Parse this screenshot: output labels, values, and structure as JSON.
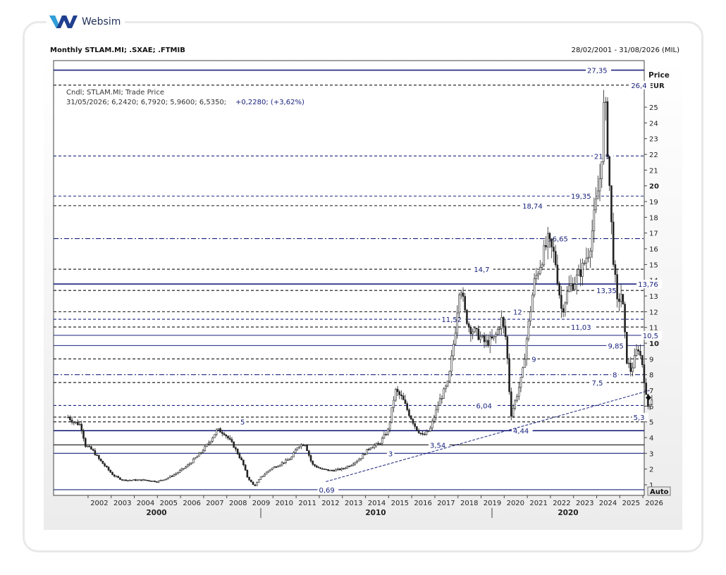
{
  "brand": {
    "name": "Websim"
  },
  "header": {
    "title": "Monthly STLAM.MI; .SXAE; .FTMIB",
    "date_range": "28/02/2001 - 31/08/2026 (MIL)"
  },
  "legend": {
    "line1": "Cndl; STLAM.MI; Trade Price",
    "ohlc": "31/05/2026; 6,2420; 6,7920; 5,9600; 6,5350;",
    "change": "+0,2280; (+3,62%)"
  },
  "axis": {
    "y_title_1": "Price",
    "y_title_2": "EUR",
    "auto_label": "Auto",
    "y_ticks": [
      "1",
      "2",
      "3",
      "4",
      "5",
      "6",
      "7",
      "8",
      "9",
      "10",
      "11",
      "12",
      "13",
      "14",
      "15",
      "16",
      "17",
      "18",
      "19",
      "20",
      "21",
      "22",
      "23",
      "24",
      "25"
    ],
    "x_ticks": [
      "2002",
      "2003",
      "2004",
      "2005",
      "2006",
      "2007",
      "2008",
      "2009",
      "2010",
      "2011",
      "2012",
      "2013",
      "2014",
      "2015",
      "2016",
      "2017",
      "2018",
      "2019",
      "2020",
      "2021",
      "2022",
      "2023",
      "2024",
      "2025",
      "2026"
    ],
    "decades": [
      "2000",
      "2010",
      "2020"
    ]
  },
  "colors": {
    "navy": "#1a237e",
    "black": "#111111",
    "candle": "#222222"
  },
  "chart_data": {
    "type": "candlestick",
    "y_unit": "EUR",
    "ylim": [
      0.3,
      27.8
    ],
    "xlim": [
      2001.1,
      2026.75
    ],
    "close_path": [
      [
        2001.15,
        5.3
      ],
      [
        2001.4,
        5.0
      ],
      [
        2001.7,
        4.8
      ],
      [
        2001.9,
        3.5
      ],
      [
        2002.2,
        3.2
      ],
      [
        2002.5,
        2.6
      ],
      [
        2002.8,
        2.1
      ],
      [
        2003.1,
        1.6
      ],
      [
        2003.5,
        1.3
      ],
      [
        2004.0,
        1.3
      ],
      [
        2004.5,
        1.3
      ],
      [
        2005.0,
        1.2
      ],
      [
        2005.4,
        1.4
      ],
      [
        2005.8,
        1.7
      ],
      [
        2006.3,
        2.2
      ],
      [
        2006.8,
        2.9
      ],
      [
        2007.2,
        3.6
      ],
      [
        2007.6,
        4.5
      ],
      [
        2007.9,
        4.3
      ],
      [
        2008.3,
        3.5
      ],
      [
        2008.7,
        2.4
      ],
      [
        2008.9,
        1.5
      ],
      [
        2009.2,
        0.9
      ],
      [
        2009.5,
        1.5
      ],
      [
        2009.9,
        2.0
      ],
      [
        2010.3,
        2.3
      ],
      [
        2010.8,
        2.7
      ],
      [
        2011.1,
        3.5
      ],
      [
        2011.4,
        3.6
      ],
      [
        2011.7,
        2.3
      ],
      [
        2012.1,
        2.0
      ],
      [
        2012.5,
        1.9
      ],
      [
        2013.0,
        2.0
      ],
      [
        2013.4,
        2.3
      ],
      [
        2013.8,
        2.7
      ],
      [
        2014.2,
        3.4
      ],
      [
        2014.6,
        3.6
      ],
      [
        2015.0,
        4.5
      ],
      [
        2015.3,
        7.0
      ],
      [
        2015.6,
        6.5
      ],
      [
        2015.9,
        5.5
      ],
      [
        2016.2,
        4.6
      ],
      [
        2016.5,
        4.1
      ],
      [
        2016.8,
        4.5
      ],
      [
        2017.2,
        6.3
      ],
      [
        2017.6,
        7.5
      ],
      [
        2017.9,
        10.9
      ],
      [
        2018.1,
        14.0
      ],
      [
        2018.3,
        12.0
      ],
      [
        2018.5,
        11.0
      ],
      [
        2018.9,
        10.5
      ],
      [
        2019.2,
        10.0
      ],
      [
        2019.6,
        10.3
      ],
      [
        2019.9,
        11.5
      ],
      [
        2020.1,
        10.2
      ],
      [
        2020.3,
        5.4
      ],
      [
        2020.5,
        6.4
      ],
      [
        2020.8,
        8.0
      ],
      [
        2021.0,
        10.5
      ],
      [
        2021.3,
        13.8
      ],
      [
        2021.6,
        15.2
      ],
      [
        2021.9,
        16.5
      ],
      [
        2022.2,
        15.5
      ],
      [
        2022.5,
        12.0
      ],
      [
        2022.8,
        13.5
      ],
      [
        2023.1,
        14.0
      ],
      [
        2023.4,
        14.8
      ],
      [
        2023.7,
        16.0
      ],
      [
        2024.0,
        19.0
      ],
      [
        2024.2,
        21.0
      ],
      [
        2024.35,
        26.0
      ],
      [
        2024.5,
        22.0
      ],
      [
        2024.7,
        16.0
      ],
      [
        2024.9,
        12.5
      ],
      [
        2025.1,
        13.3
      ],
      [
        2025.3,
        9.0
      ],
      [
        2025.5,
        8.2
      ],
      [
        2025.8,
        9.8
      ],
      [
        2026.0,
        8.6
      ],
      [
        2026.2,
        5.9
      ],
      [
        2026.4,
        6.5
      ]
    ],
    "levels": [
      {
        "value": 27.35,
        "label": "27,35",
        "style": "solid",
        "color": "navy",
        "label_x": 2023.6
      },
      {
        "value": 26.4,
        "label": "26,4",
        "style": "dashed",
        "color": "black",
        "label_x": 2025.5
      },
      {
        "value": 21.9,
        "label": "21,9",
        "style": "dashed",
        "color": "navy",
        "label_x": 2023.9
      },
      {
        "value": 19.35,
        "label": "19,35",
        "style": "dashed",
        "color": "navy",
        "label_x": 2022.9
      },
      {
        "value": 18.74,
        "label": "18,74",
        "style": "dashed",
        "color": "black",
        "label_x": 2020.8
      },
      {
        "value": 16.65,
        "label": "16,65",
        "style": "dashdot",
        "color": "navy",
        "label_x": 2021.9
      },
      {
        "value": 14.7,
        "label": "14,7",
        "style": "dashed",
        "color": "black",
        "label_x": 2018.7
      },
      {
        "value": 13.76,
        "label": "13,76",
        "style": "solid",
        "color": "navy",
        "label_x": 2025.8
      },
      {
        "value": 13.35,
        "label": "13,35",
        "style": "dashed",
        "color": "black",
        "label_x": 2024.0
      },
      {
        "value": 12,
        "label": "12",
        "style": "dashed",
        "color": "black",
        "label_x": 2020.4
      },
      {
        "value": 11.52,
        "label": "11,52",
        "style": "dashed",
        "color": "navy",
        "label_x": 2017.3
      },
      {
        "value": 11.03,
        "label": "11,03",
        "style": "dashed",
        "color": "black",
        "label_x": 2022.9
      },
      {
        "value": 10.5,
        "label": "10,5",
        "style": "solid",
        "color": "navy",
        "label_x": 2026.0
      },
      {
        "value": 9.85,
        "label": "9,85",
        "style": "solid",
        "color": "navy",
        "label_x": 2024.5
      },
      {
        "value": 9,
        "label": "9",
        "style": "dashed",
        "color": "black",
        "label_x": 2021.2
      },
      {
        "value": 8,
        "label": "8",
        "style": "dashdot",
        "color": "navy",
        "label_x": 2024.7
      },
      {
        "value": 7.5,
        "label": "7,5",
        "style": "dashed",
        "color": "black",
        "label_x": 2023.8
      },
      {
        "value": 6.04,
        "label": "6,04",
        "style": "dashed",
        "color": "navy",
        "label_x": 2018.8
      },
      {
        "value": 5.3,
        "label": "5,3",
        "style": "dashed",
        "color": "black",
        "label_x": 2025.6
      },
      {
        "value": 5,
        "label": "5",
        "style": "dashed",
        "color": "black",
        "label_x": 2008.6
      },
      {
        "value": 4.44,
        "label": "4,44",
        "style": "solid",
        "color": "navy",
        "label_x": 2020.4
      },
      {
        "value": 3.54,
        "label": "3,54",
        "style": "solid",
        "color": "black",
        "label_x": 2016.8
      },
      {
        "value": 3,
        "label": "3",
        "style": "solid",
        "color": "navy",
        "label_x": 2015.0
      },
      {
        "value": 0.69,
        "label": "0,69",
        "style": "solid",
        "color": "navy",
        "label_x": 2012.0
      }
    ],
    "trendline": [
      [
        2012.3,
        1.2
      ],
      [
        2026.3,
        7.0
      ]
    ],
    "last_price": 6.535
  }
}
